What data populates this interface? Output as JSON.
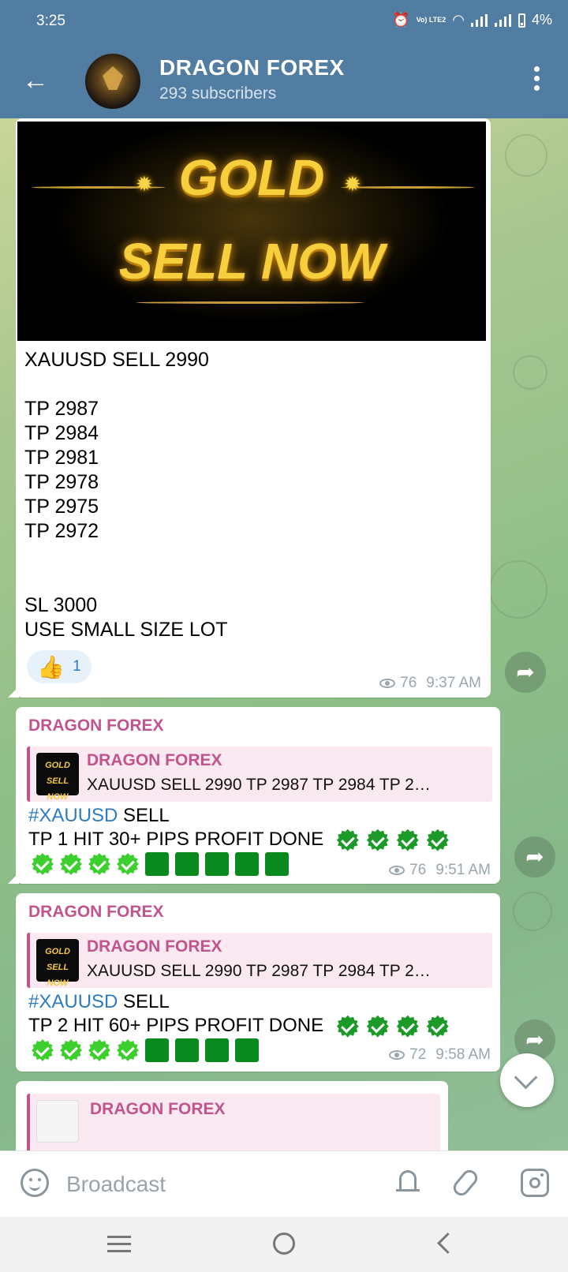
{
  "status": {
    "time": "3:25",
    "net": "Vo) LTE2",
    "battery": "4%"
  },
  "header": {
    "title": "DRAGON FOREX",
    "subtitle": "293 subscribers"
  },
  "post1": {
    "image_line1": "GOLD",
    "image_line2": "SELL NOW",
    "lines": [
      "XAUUSD SELL 2990",
      "TP 2987",
      "TP 2984",
      "TP 2981",
      "TP 2978",
      "TP 2975",
      "TP 2972",
      "SL 3000",
      "USE SMALL SIZE LOT"
    ],
    "reaction_count": "1",
    "views": "76",
    "time": "9:37 AM"
  },
  "post2": {
    "sender": "DRAGON FOREX",
    "quote_name": "DRAGON FOREX",
    "quote_text": "XAUUSD SELL 2990  TP 2987 TP 2984 TP 2…",
    "thumb_line1": "GOLD",
    "thumb_line2": "SELL NOW",
    "hashtag": "#XAUUSD",
    "after_hash": " SELL",
    "hit": "TP 1 HIT 30+ PIPS PROFIT DONE",
    "views": "76",
    "time": "9:51 AM"
  },
  "post3": {
    "sender": "DRAGON FOREX",
    "quote_name": "DRAGON FOREX",
    "quote_text": "XAUUSD SELL 2990  TP 2987 TP 2984 TP 2…",
    "thumb_line1": "GOLD",
    "thumb_line2": "SELL NOW",
    "hashtag": "#XAUUSD",
    "after_hash": " SELL",
    "hit": "TP 2 HIT 60+ PIPS PROFIT DONE",
    "views": "72",
    "time": "9:58 AM"
  },
  "post4": {
    "quote_name": "DRAGON FOREX"
  },
  "input": {
    "placeholder": "Broadcast"
  },
  "colors": {
    "header": "#517da2",
    "sender": "#c0548d",
    "hashtag": "#2f7bc0",
    "check": "#1c9a27"
  }
}
